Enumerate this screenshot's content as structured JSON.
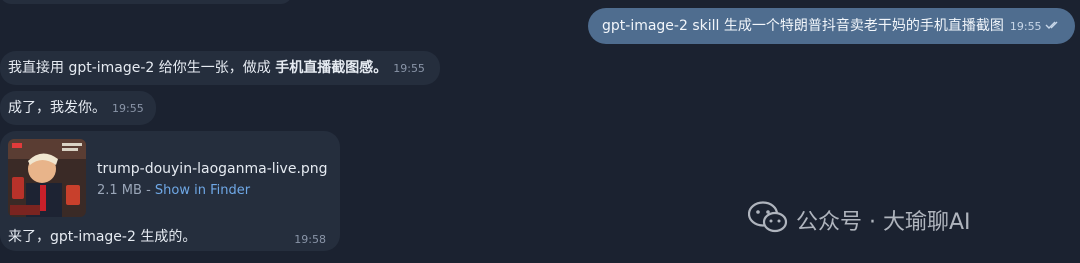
{
  "chat": {
    "outgoing": {
      "text": "gpt-image-2 skill 生成一个特朗普抖音卖老干妈的手机直播截图",
      "time": "19:55"
    },
    "msg1": {
      "prefix": "我直接用 gpt-image-2 给你生一张，做成 ",
      "bold": "手机直播截图感。",
      "time": "19:55"
    },
    "msg2": {
      "text": "成了，我发你。",
      "time": "19:55"
    },
    "file": {
      "name": "trump-douyin-laoganma-live.png",
      "size": "2.1 MB",
      "separator": " - ",
      "link": "Show in Finder",
      "caption": "来了，gpt-image-2 生成的。",
      "time": "19:58"
    }
  },
  "watermark": {
    "text": "公众号 · 大瑜聊AI",
    "icon": "wechat-icon"
  },
  "colors": {
    "background": "#1b2230",
    "incoming_bubble": "#252e3d",
    "outgoing_bubble": "#4f6d8f",
    "link": "#6fa8e6"
  }
}
